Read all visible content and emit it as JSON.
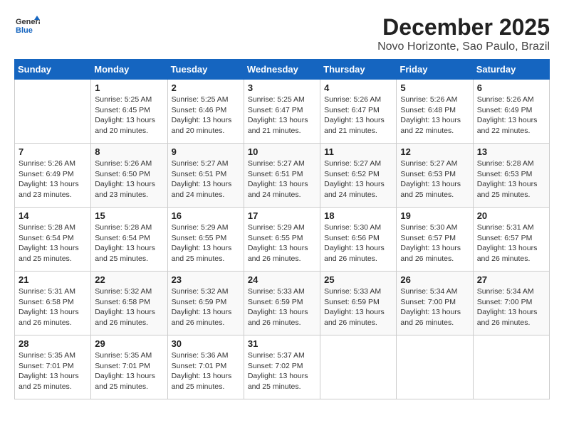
{
  "header": {
    "logo_line1": "General",
    "logo_line2": "Blue",
    "month": "December 2025",
    "location": "Novo Horizonte, Sao Paulo, Brazil"
  },
  "weekdays": [
    "Sunday",
    "Monday",
    "Tuesday",
    "Wednesday",
    "Thursday",
    "Friday",
    "Saturday"
  ],
  "weeks": [
    [
      {
        "day": "",
        "sunrise": "",
        "sunset": "",
        "daylight": ""
      },
      {
        "day": "1",
        "sunrise": "Sunrise: 5:25 AM",
        "sunset": "Sunset: 6:45 PM",
        "daylight": "Daylight: 13 hours and 20 minutes."
      },
      {
        "day": "2",
        "sunrise": "Sunrise: 5:25 AM",
        "sunset": "Sunset: 6:46 PM",
        "daylight": "Daylight: 13 hours and 20 minutes."
      },
      {
        "day": "3",
        "sunrise": "Sunrise: 5:25 AM",
        "sunset": "Sunset: 6:47 PM",
        "daylight": "Daylight: 13 hours and 21 minutes."
      },
      {
        "day": "4",
        "sunrise": "Sunrise: 5:26 AM",
        "sunset": "Sunset: 6:47 PM",
        "daylight": "Daylight: 13 hours and 21 minutes."
      },
      {
        "day": "5",
        "sunrise": "Sunrise: 5:26 AM",
        "sunset": "Sunset: 6:48 PM",
        "daylight": "Daylight: 13 hours and 22 minutes."
      },
      {
        "day": "6",
        "sunrise": "Sunrise: 5:26 AM",
        "sunset": "Sunset: 6:49 PM",
        "daylight": "Daylight: 13 hours and 22 minutes."
      }
    ],
    [
      {
        "day": "7",
        "sunrise": "Sunrise: 5:26 AM",
        "sunset": "Sunset: 6:49 PM",
        "daylight": "Daylight: 13 hours and 23 minutes."
      },
      {
        "day": "8",
        "sunrise": "Sunrise: 5:26 AM",
        "sunset": "Sunset: 6:50 PM",
        "daylight": "Daylight: 13 hours and 23 minutes."
      },
      {
        "day": "9",
        "sunrise": "Sunrise: 5:27 AM",
        "sunset": "Sunset: 6:51 PM",
        "daylight": "Daylight: 13 hours and 24 minutes."
      },
      {
        "day": "10",
        "sunrise": "Sunrise: 5:27 AM",
        "sunset": "Sunset: 6:51 PM",
        "daylight": "Daylight: 13 hours and 24 minutes."
      },
      {
        "day": "11",
        "sunrise": "Sunrise: 5:27 AM",
        "sunset": "Sunset: 6:52 PM",
        "daylight": "Daylight: 13 hours and 24 minutes."
      },
      {
        "day": "12",
        "sunrise": "Sunrise: 5:27 AM",
        "sunset": "Sunset: 6:53 PM",
        "daylight": "Daylight: 13 hours and 25 minutes."
      },
      {
        "day": "13",
        "sunrise": "Sunrise: 5:28 AM",
        "sunset": "Sunset: 6:53 PM",
        "daylight": "Daylight: 13 hours and 25 minutes."
      }
    ],
    [
      {
        "day": "14",
        "sunrise": "Sunrise: 5:28 AM",
        "sunset": "Sunset: 6:54 PM",
        "daylight": "Daylight: 13 hours and 25 minutes."
      },
      {
        "day": "15",
        "sunrise": "Sunrise: 5:28 AM",
        "sunset": "Sunset: 6:54 PM",
        "daylight": "Daylight: 13 hours and 25 minutes."
      },
      {
        "day": "16",
        "sunrise": "Sunrise: 5:29 AM",
        "sunset": "Sunset: 6:55 PM",
        "daylight": "Daylight: 13 hours and 25 minutes."
      },
      {
        "day": "17",
        "sunrise": "Sunrise: 5:29 AM",
        "sunset": "Sunset: 6:55 PM",
        "daylight": "Daylight: 13 hours and 26 minutes."
      },
      {
        "day": "18",
        "sunrise": "Sunrise: 5:30 AM",
        "sunset": "Sunset: 6:56 PM",
        "daylight": "Daylight: 13 hours and 26 minutes."
      },
      {
        "day": "19",
        "sunrise": "Sunrise: 5:30 AM",
        "sunset": "Sunset: 6:57 PM",
        "daylight": "Daylight: 13 hours and 26 minutes."
      },
      {
        "day": "20",
        "sunrise": "Sunrise: 5:31 AM",
        "sunset": "Sunset: 6:57 PM",
        "daylight": "Daylight: 13 hours and 26 minutes."
      }
    ],
    [
      {
        "day": "21",
        "sunrise": "Sunrise: 5:31 AM",
        "sunset": "Sunset: 6:58 PM",
        "daylight": "Daylight: 13 hours and 26 minutes."
      },
      {
        "day": "22",
        "sunrise": "Sunrise: 5:32 AM",
        "sunset": "Sunset: 6:58 PM",
        "daylight": "Daylight: 13 hours and 26 minutes."
      },
      {
        "day": "23",
        "sunrise": "Sunrise: 5:32 AM",
        "sunset": "Sunset: 6:59 PM",
        "daylight": "Daylight: 13 hours and 26 minutes."
      },
      {
        "day": "24",
        "sunrise": "Sunrise: 5:33 AM",
        "sunset": "Sunset: 6:59 PM",
        "daylight": "Daylight: 13 hours and 26 minutes."
      },
      {
        "day": "25",
        "sunrise": "Sunrise: 5:33 AM",
        "sunset": "Sunset: 6:59 PM",
        "daylight": "Daylight: 13 hours and 26 minutes."
      },
      {
        "day": "26",
        "sunrise": "Sunrise: 5:34 AM",
        "sunset": "Sunset: 7:00 PM",
        "daylight": "Daylight: 13 hours and 26 minutes."
      },
      {
        "day": "27",
        "sunrise": "Sunrise: 5:34 AM",
        "sunset": "Sunset: 7:00 PM",
        "daylight": "Daylight: 13 hours and 26 minutes."
      }
    ],
    [
      {
        "day": "28",
        "sunrise": "Sunrise: 5:35 AM",
        "sunset": "Sunset: 7:01 PM",
        "daylight": "Daylight: 13 hours and 25 minutes."
      },
      {
        "day": "29",
        "sunrise": "Sunrise: 5:35 AM",
        "sunset": "Sunset: 7:01 PM",
        "daylight": "Daylight: 13 hours and 25 minutes."
      },
      {
        "day": "30",
        "sunrise": "Sunrise: 5:36 AM",
        "sunset": "Sunset: 7:01 PM",
        "daylight": "Daylight: 13 hours and 25 minutes."
      },
      {
        "day": "31",
        "sunrise": "Sunrise: 5:37 AM",
        "sunset": "Sunset: 7:02 PM",
        "daylight": "Daylight: 13 hours and 25 minutes."
      },
      {
        "day": "",
        "sunrise": "",
        "sunset": "",
        "daylight": ""
      },
      {
        "day": "",
        "sunrise": "",
        "sunset": "",
        "daylight": ""
      },
      {
        "day": "",
        "sunrise": "",
        "sunset": "",
        "daylight": ""
      }
    ]
  ]
}
